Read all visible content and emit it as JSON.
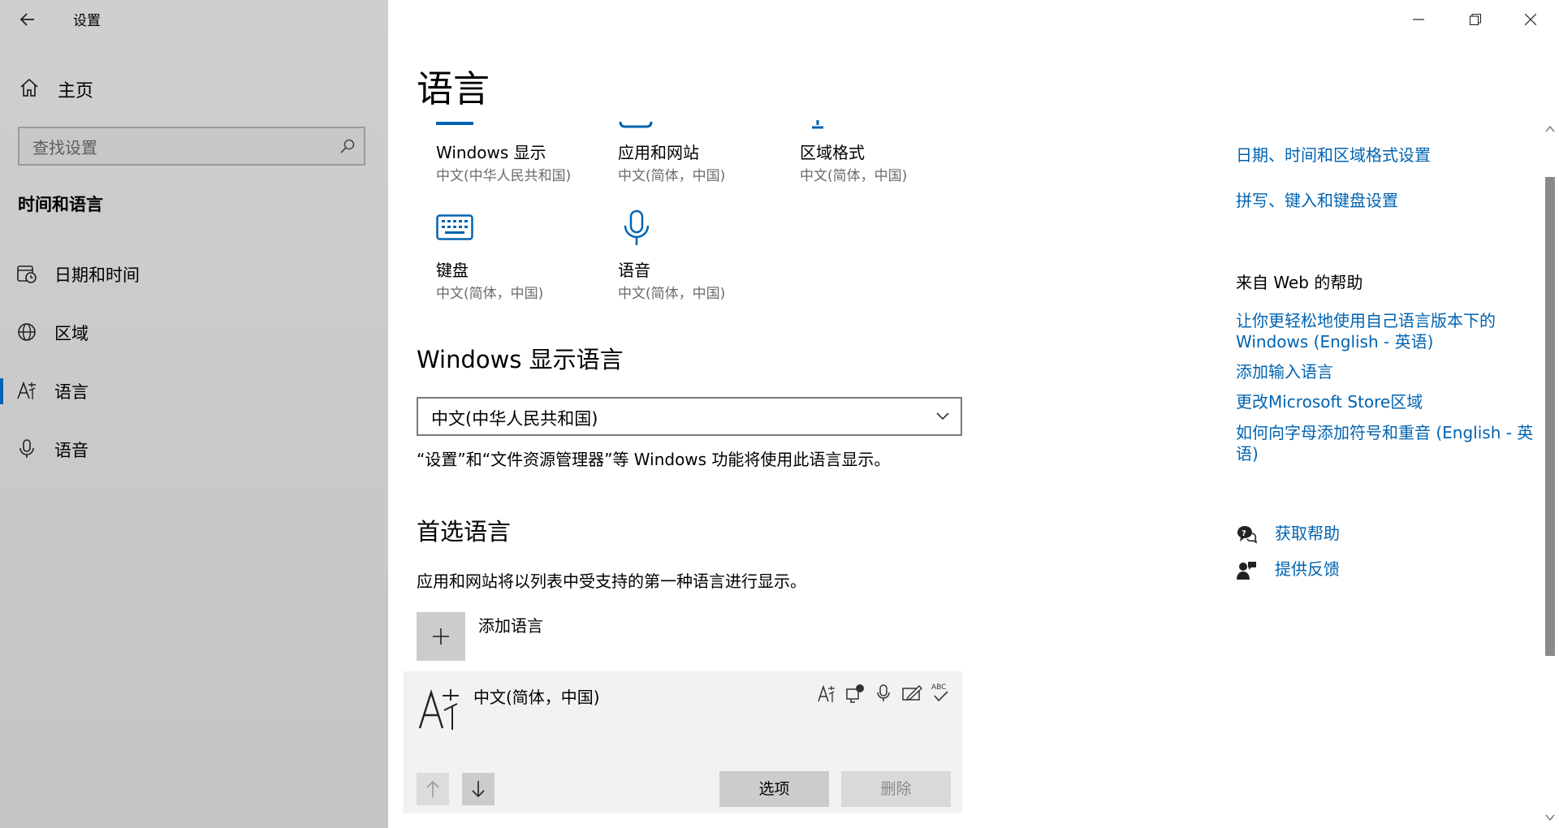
{
  "window": {
    "title": "设置"
  },
  "sidebar": {
    "home_label": "主页",
    "search_placeholder": "查找设置",
    "section_title": "时间和语言",
    "items": [
      {
        "label": "日期和时间",
        "icon": "calendar-clock-icon"
      },
      {
        "label": "区域",
        "icon": "globe-icon"
      },
      {
        "label": "语言",
        "icon": "language-icon",
        "selected": true
      },
      {
        "label": "语音",
        "icon": "microphone-icon"
      }
    ]
  },
  "main": {
    "page_title": "语言",
    "tiles_row1": [
      {
        "label": "Windows 显示",
        "sub": "中文(中华人民共和国)"
      },
      {
        "label": "应用和网站",
        "sub": "中文(简体，中国)"
      },
      {
        "label": "区域格式",
        "sub": "中文(简体，中国)"
      }
    ],
    "tiles_row2": [
      {
        "label": "键盘",
        "sub": "中文(简体，中国)",
        "icon": "keyboard-icon"
      },
      {
        "label": "语音",
        "sub": "中文(简体，中国)",
        "icon": "microphone-icon"
      }
    ],
    "display_language": {
      "heading": "Windows 显示语言",
      "selected": "中文(中华人民共和国)",
      "description": "“设置”和“文件资源管理器”等 Windows 功能将使用此语言显示。"
    },
    "preferred": {
      "heading": "首选语言",
      "description": "应用和网站将以列表中受支持的第一种语言进行显示。",
      "add_label": "添加语言",
      "language_name": "中文(简体，中国)",
      "options_label": "选项",
      "remove_label": "删除"
    }
  },
  "right_pane": {
    "related_links": [
      "日期、时间和区域格式设置",
      "拼写、键入和键盘设置"
    ],
    "web_help_heading": "来自 Web 的帮助",
    "web_help_links": [
      "让你更轻松地使用自己语言版本下的 Windows (English - 英语)",
      "添加输入语言",
      "更改Microsoft Store区域",
      "如何向字母添加符号和重音 (English - 英语)"
    ],
    "get_help": "获取帮助",
    "feedback": "提供反馈"
  },
  "colors": {
    "accent": "#0063b1",
    "sidebar_bg": "#c9c9c9",
    "card_bg": "#f2f2f2",
    "button_bg": "#cccccc"
  }
}
